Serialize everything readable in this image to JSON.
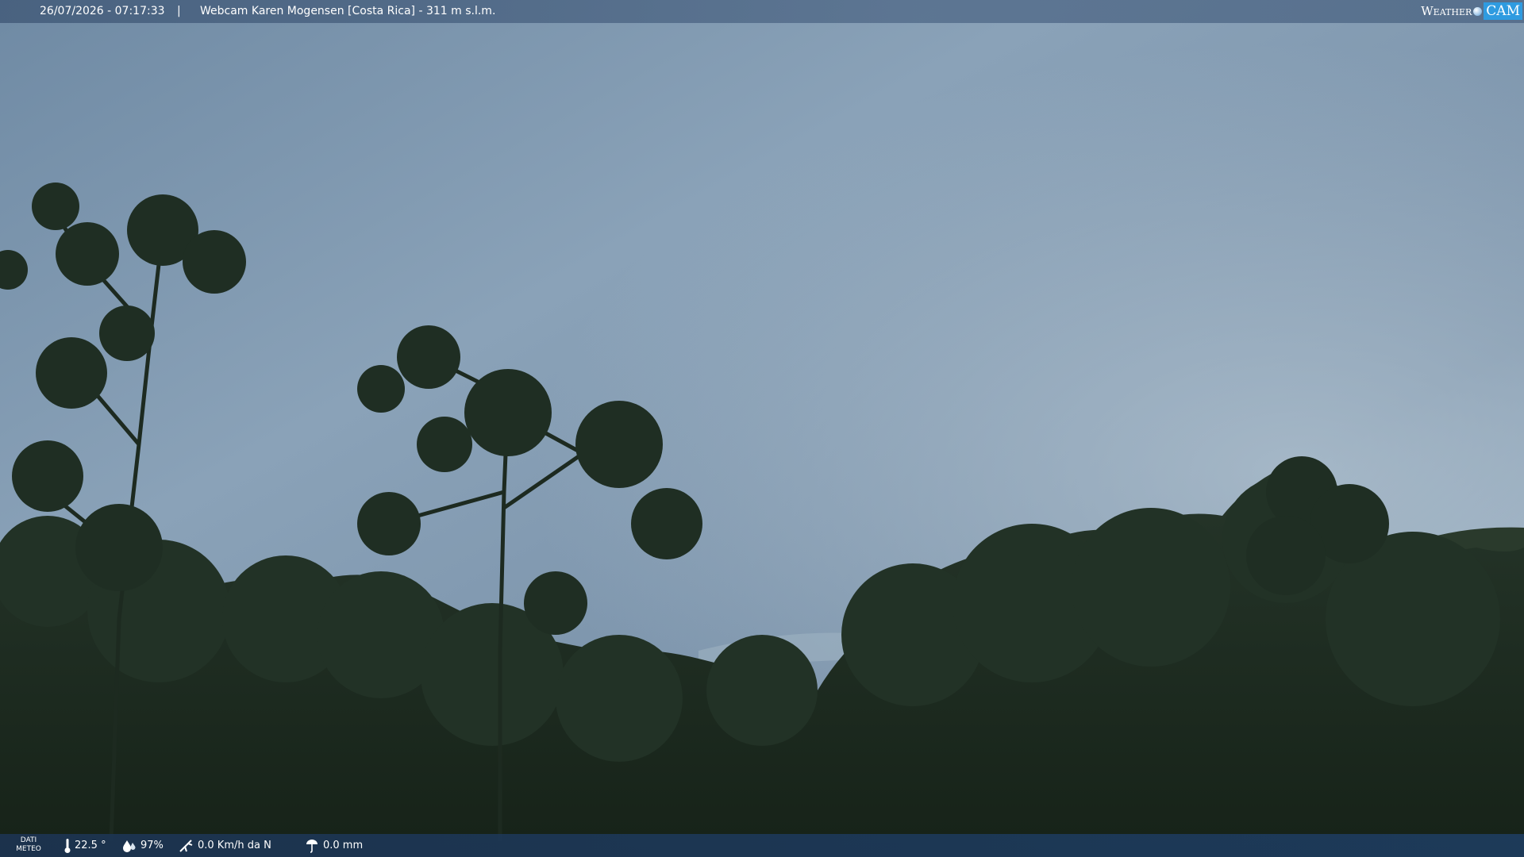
{
  "header": {
    "datetime": "26/07/2026 - 07:17:33",
    "separator": "|",
    "title": "Webcam Karen Mogensen [Costa Rica] - 311 m s.l.m."
  },
  "logo": {
    "weather": "Weather",
    "cam": "CAM"
  },
  "meteo": {
    "label_line1": "DATI",
    "label_line2": "METEO",
    "temperature": "22.5 °",
    "humidity": "97%",
    "wind": "0.0 Km/h da N",
    "rain": "0.0 mm"
  },
  "icons": {
    "temperature": "thermometer-icon",
    "humidity": "humidity-icon",
    "wind": "wind-icon",
    "rain": "rain-icon"
  },
  "colors": {
    "sky_top": "#5f7a95",
    "sky_mid": "#8aa3b9",
    "forest": "#1c2a1f",
    "logo_accent": "#2f9be0"
  }
}
